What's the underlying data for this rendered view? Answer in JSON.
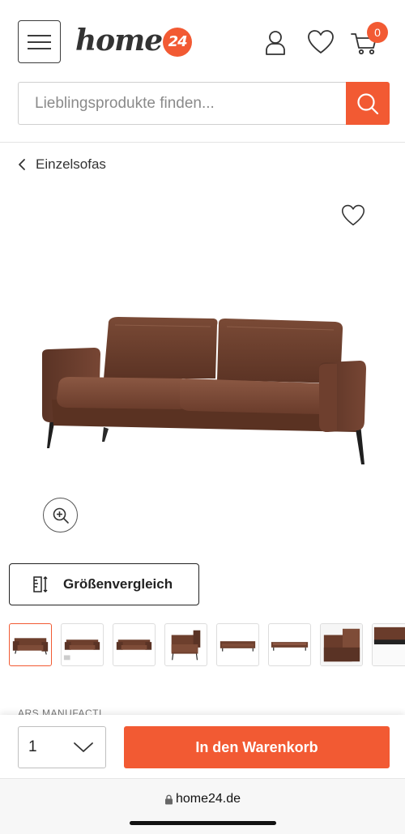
{
  "header": {
    "logo_text": "home",
    "logo_badge": "24",
    "cart_count": "0"
  },
  "search": {
    "placeholder": "Lieblingsprodukte finden..."
  },
  "breadcrumb": {
    "label": "Einzelsofas"
  },
  "product": {
    "size_compare_label": "Größenvergleich",
    "brand_peek": "ARS MANUFACTI",
    "thumbnail_count": 8
  },
  "purchase": {
    "quantity": "1",
    "add_to_cart_label": "In den Warenkorb"
  },
  "browser": {
    "url": "home24.de"
  },
  "colors": {
    "brand": "#f25a33",
    "text": "#333333"
  },
  "icons": [
    "menu-icon",
    "account-icon",
    "wishlist-icon",
    "cart-icon",
    "search-icon",
    "chevron-left-icon",
    "zoom-in-icon",
    "ruler-icon",
    "chevron-down-icon",
    "lock-icon"
  ]
}
